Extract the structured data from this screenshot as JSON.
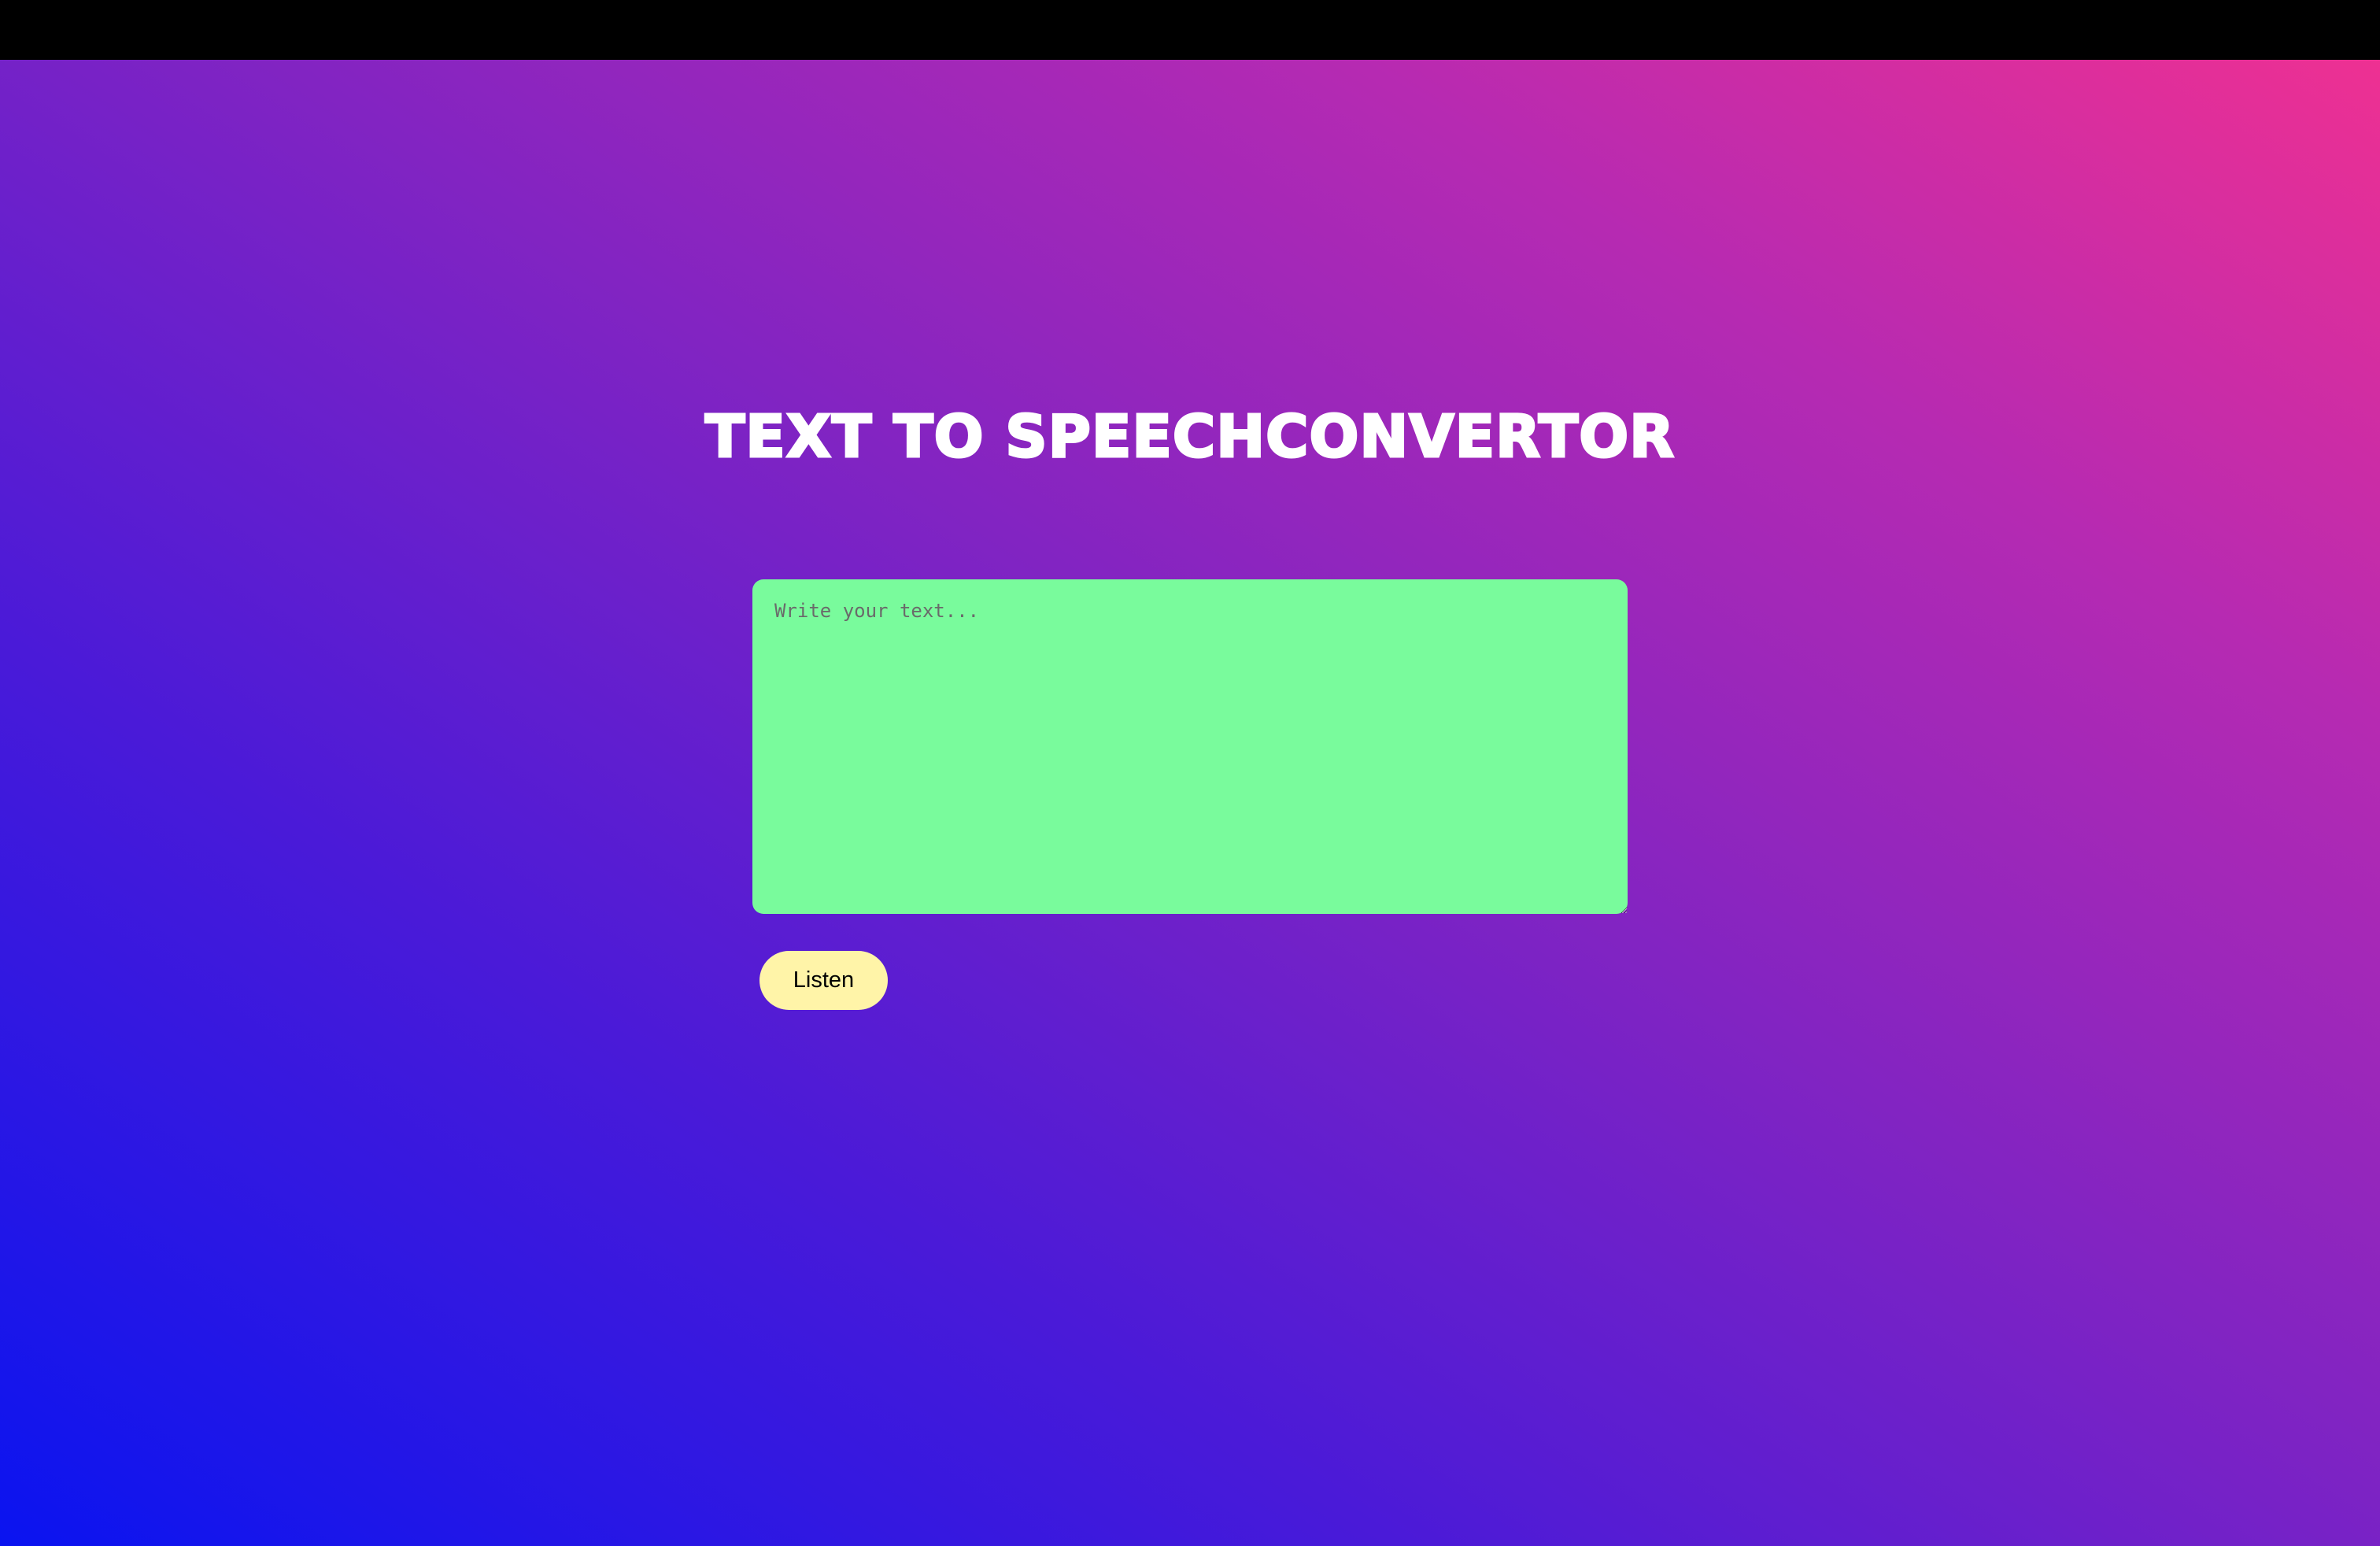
{
  "page": {
    "title": "Text to SpeechConvertor"
  },
  "editor": {
    "placeholder": "Write your text...",
    "value": ""
  },
  "actions": {
    "listen_label": "Listen"
  },
  "colors": {
    "top_bar": "#000000",
    "gradient_start": "#0a14f0",
    "gradient_end": "#ee3092",
    "textarea_bg": "#79fb9c",
    "button_bg": "#fff4a8",
    "title_color": "#ffffff"
  }
}
